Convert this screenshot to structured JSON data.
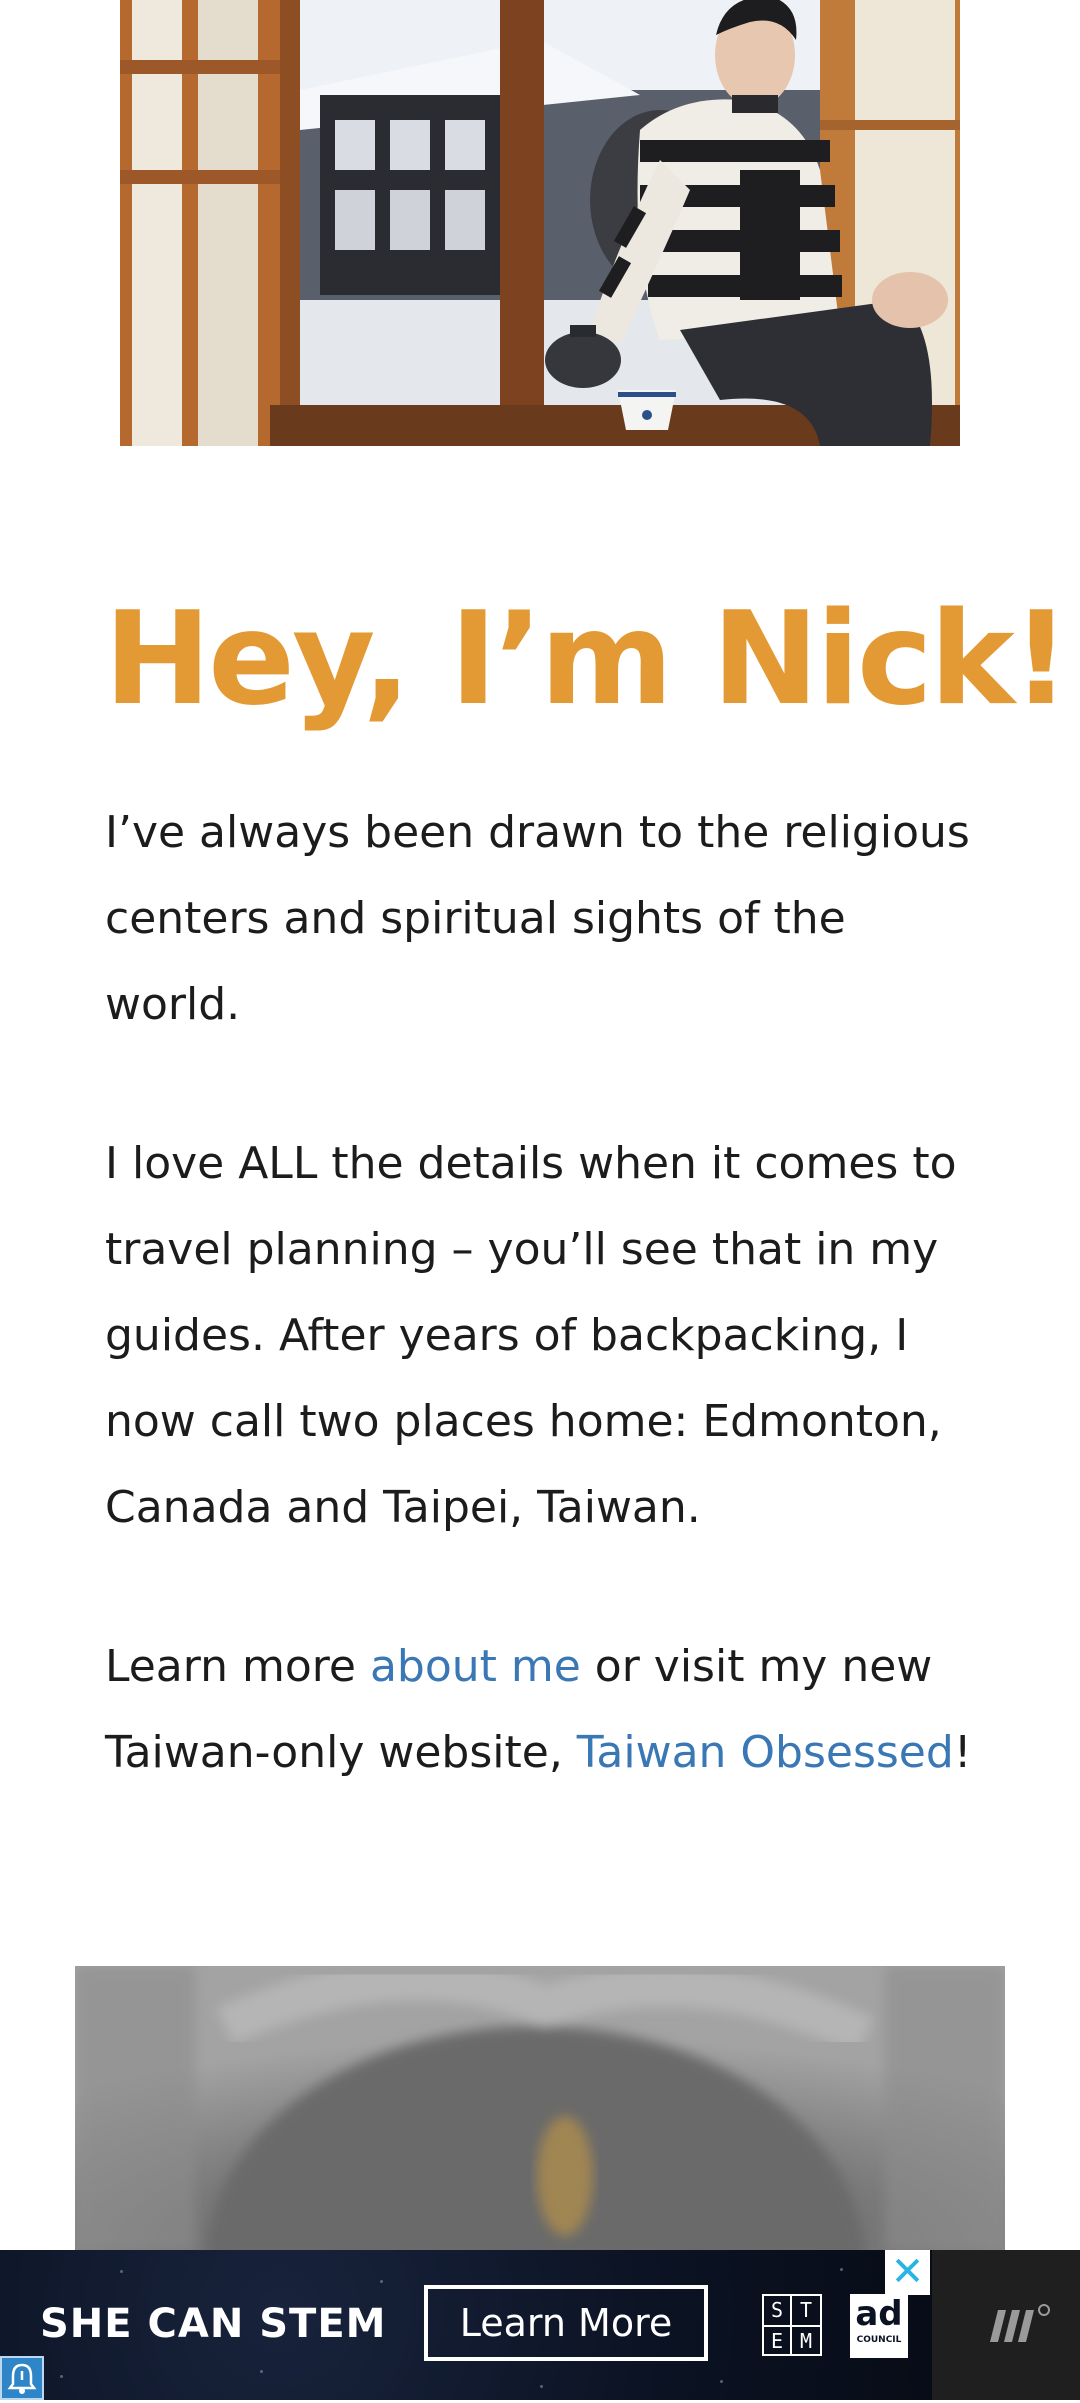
{
  "hero": {
    "image_alt": "Nick sitting by an open window with tea, snowy garden outside"
  },
  "intro": {
    "headline": "Hey, I’m Nick!",
    "paragraph_1": "I’ve always been drawn to the religious centers and spiritual sights of the world.",
    "paragraph_2": "I love ALL the details when it comes to travel planning – you’ll see that in my guides. After years of backpacking, I now call two places home: Edmonton, Canada and Taipei, Taiwan.",
    "paragraph_3": {
      "text_before_link_1": "Learn more ",
      "link_1": "about me",
      "text_between_links": " or visit my new Taiwan-only website, ",
      "link_2": "Taiwan Obsessed",
      "text_after_link_2": "!"
    }
  },
  "stone_photo": {
    "image_alt": "Blurred stone surface photo"
  },
  "ad": {
    "headline": "SHE CAN STEM",
    "cta_label": "Learn More",
    "stem_letters": [
      "S",
      "T",
      "E",
      "M"
    ],
    "adcouncil_word": "ad",
    "adcouncil_sub": "COUNCIL",
    "close_glyph": "✕",
    "colors": {
      "background": "#0b1222",
      "close_accent": "#28b5e3"
    }
  },
  "colors": {
    "headline": "#e39a35",
    "link": "#3a77b5",
    "body_text": "#1c1c1c"
  },
  "icons": {
    "ad_info": "bell-icon",
    "publisher": "publisher-logo-icon"
  }
}
